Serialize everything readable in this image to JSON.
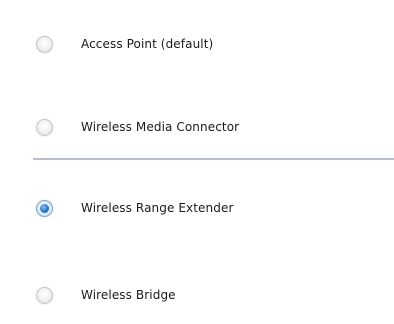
{
  "mode_options": [
    {
      "label": "Access Point (default)",
      "selected": false
    },
    {
      "label": "Wireless Media Connector",
      "selected": false
    },
    {
      "label": "Wireless Range Extender",
      "selected": true
    },
    {
      "label": "Wireless Bridge",
      "selected": false
    }
  ],
  "colors": {
    "divider": "#b9bccf",
    "selected_radio": "#2d76c6",
    "text": "#1a1a1a"
  }
}
